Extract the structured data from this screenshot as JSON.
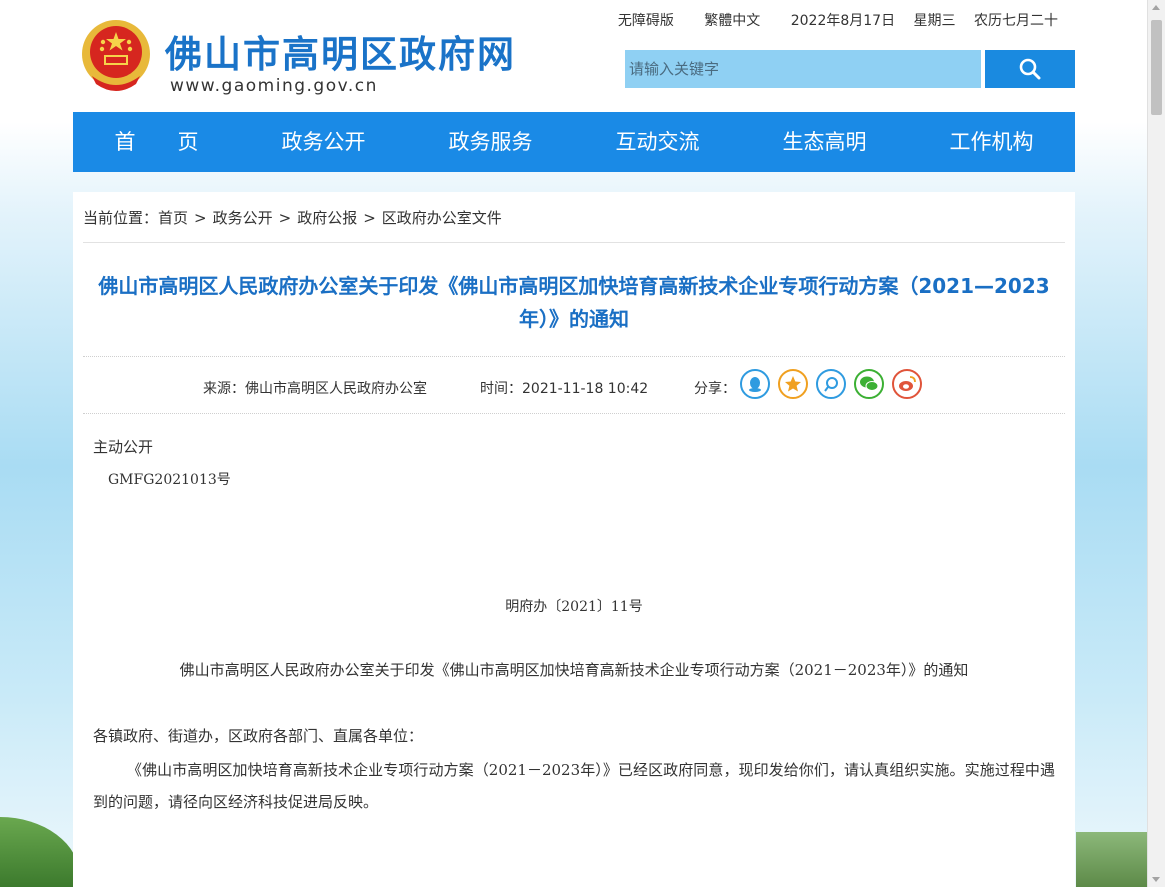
{
  "header": {
    "site_title": "佛山市高明区政府网",
    "site_url": "www.gaoming.gov.cn",
    "top_links": [
      "无障碍版",
      "繁體中文"
    ],
    "date": "2022年8月17日",
    "weekday": "星期三",
    "lunar": "农历七月二十",
    "search_placeholder": "请输入关键字"
  },
  "nav": [
    "首　　页",
    "政务公开",
    "政务服务",
    "互动交流",
    "生态高明",
    "工作机构"
  ],
  "breadcrumb": {
    "prefix": "当前位置：",
    "items": [
      "首页",
      "政务公开",
      "政府公报",
      "区政府办公室文件"
    ],
    "separator": ">"
  },
  "article": {
    "title": "佛山市高明区人民政府办公室关于印发《佛山市高明区加快培育高新技术企业专项行动方案（2021—2023年）》的通知",
    "source": "来源：佛山市高明区人民政府办公室",
    "time": "时间：2021-11-18 10:42",
    "share_label": "分享：",
    "share_icons": [
      "qq-icon",
      "qzone-star-icon",
      "pengyou-icon",
      "wechat-icon",
      "weibo-icon"
    ],
    "disclosure_type": "主动公开",
    "doc_code": "GMFG2021013号",
    "doc_number": "明府办〔2021〕11号",
    "heading": "佛山市高明区人民政府办公室关于印发《佛山市高明区加快培育高新技术企业专项行动方案（2021－2023年）》的通知",
    "addressee": "各镇政府、街道办，区政府各部门、直属各单位：",
    "paragraph": "《佛山市高明区加快培育高新技术企业专项行动方案（2021－2023年）》已经区政府同意，现印发给你们，请认真组织实施。实施过程中遇到的问题，请径向区经济科技促进局反映。"
  },
  "colors": {
    "brand_blue": "#1a8ae6",
    "title_blue": "#1a6fc4",
    "search_bg": "#8fd0f3"
  }
}
